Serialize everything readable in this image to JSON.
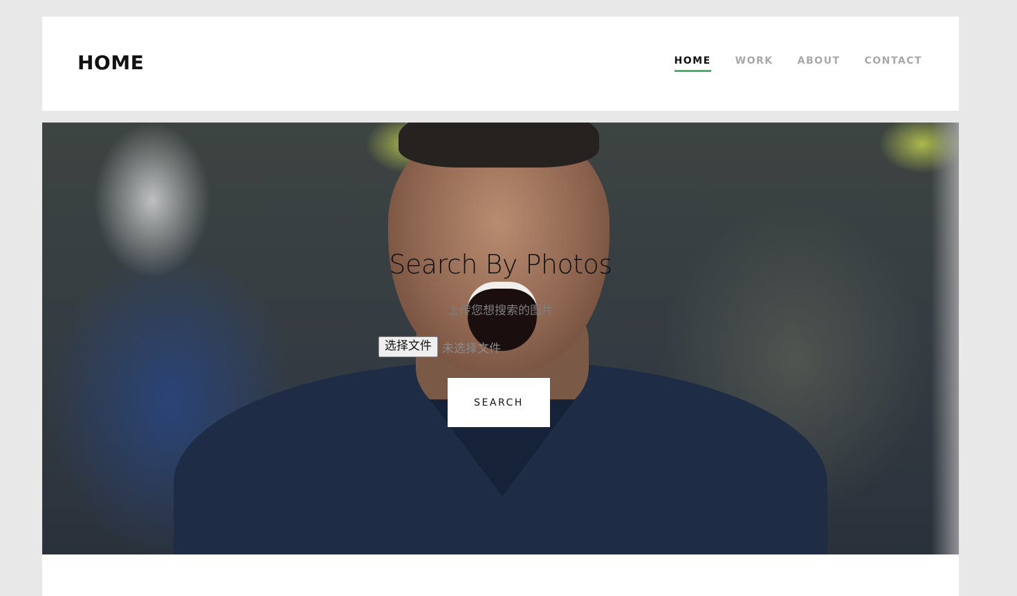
{
  "header": {
    "brand": "HOME",
    "nav": [
      {
        "label": "HOME",
        "active": true
      },
      {
        "label": "WORK",
        "active": false
      },
      {
        "label": "ABOUT",
        "active": false
      },
      {
        "label": "CONTACT",
        "active": false
      }
    ]
  },
  "hero": {
    "title": "Search By Photos",
    "subtitle": "上传您想搜索的图片",
    "file_button_label": "选择文件",
    "file_status": "未选择文件",
    "search_button_label": "SEARCH",
    "background_image": "photo-of-laughing-football-player"
  },
  "colors": {
    "accent": "#4caf72",
    "nav_inactive": "#a8a8a8",
    "page_background": "#e8e8e8"
  }
}
